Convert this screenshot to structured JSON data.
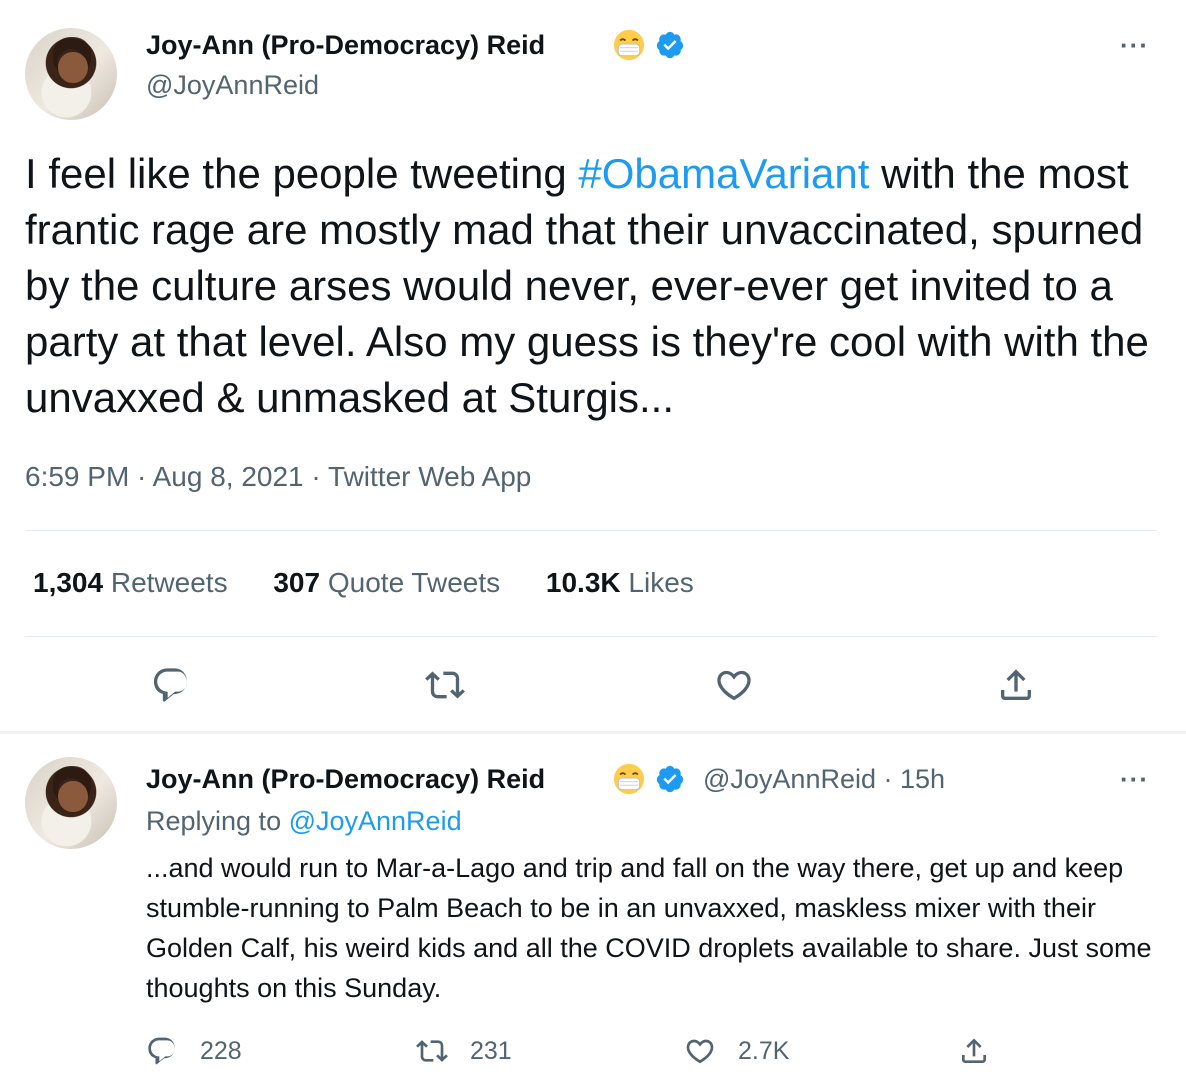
{
  "main_tweet": {
    "display_name": "Joy-Ann (Pro-Democracy) Reid",
    "handle": "@JoyAnnReid",
    "text_before": "I feel like the people tweeting ",
    "hashtag": "#ObamaVariant",
    "text_after": " with the most frantic rage are mostly mad that their unvaccinated, spurned by the culture arses would never, ever-ever get invited to a party at that level. Also my guess is they're cool with with the unvaxxed & unmasked at Sturgis...",
    "timestamp": "6:59 PM · Aug 8, 2021 · Twitter Web App",
    "stats": {
      "retweets_count": "1,304",
      "retweets_label": "Retweets",
      "quotes_count": "307",
      "quotes_label": "Quote Tweets",
      "likes_count": "10.3K",
      "likes_label": "Likes"
    },
    "more_label": "···"
  },
  "reply_tweet": {
    "display_name": "Joy-Ann (Pro-Democracy) Reid",
    "handle_time": "@JoyAnnReid · 15h",
    "replying_prefix": "Replying to ",
    "replying_handle": "@JoyAnnReid",
    "text": "...and would run to Mar-a-Lago and trip and fall on the way there, get up and keep stumble-running to Palm Beach to be in an unvaxxed, maskless mixer with their Golden Calf, his weird kids and all the COVID droplets available to share. Just some thoughts on this Sunday.",
    "reply_count": "228",
    "retweet_count": "231",
    "like_count": "2.7K",
    "more_label": "···"
  },
  "icons": {
    "reply": "reply-icon",
    "retweet": "retweet-icon",
    "like": "heart-icon",
    "share": "share-icon",
    "verified": "verified-badge-icon",
    "mask_emoji": "face-with-medical-mask-emoji"
  },
  "colors": {
    "link_blue": "#1d9bf0",
    "secondary_text": "#536471",
    "primary_text": "#0f1419",
    "divider": "#e6ecf0"
  }
}
